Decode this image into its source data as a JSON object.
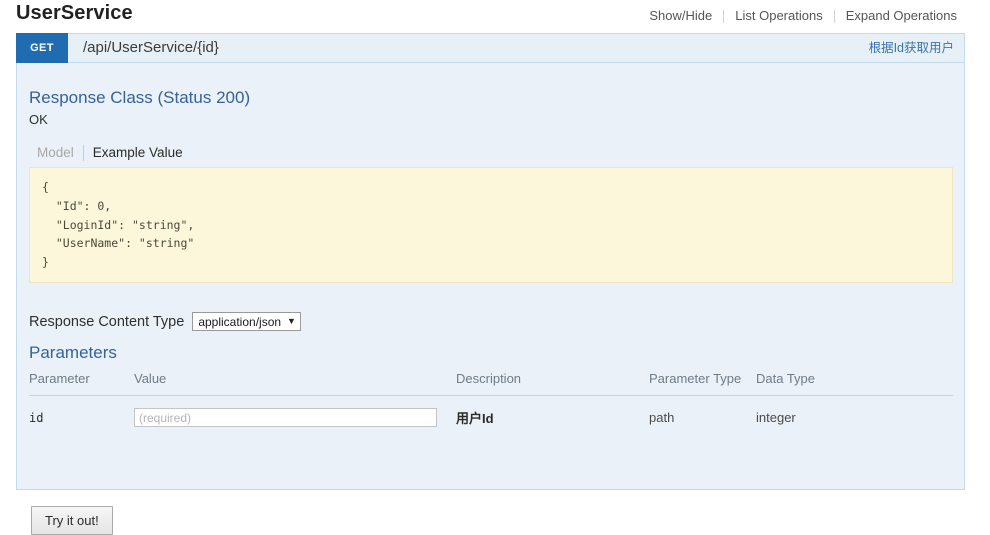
{
  "resource": {
    "title": "UserService",
    "options": [
      {
        "label": "Show/Hide"
      },
      {
        "label": "List Operations"
      },
      {
        "label": "Expand Operations"
      }
    ]
  },
  "operation": {
    "method": "GET",
    "path": "/api/UserService/{id}",
    "summary": "根据Id获取用户",
    "method_color": "#1f6cb0"
  },
  "response_class": {
    "title": "Response Class (Status 200)",
    "status_text": "OK",
    "tabs": [
      {
        "label": "Model",
        "active": false
      },
      {
        "label": "Example Value",
        "active": true
      }
    ],
    "example_value": "{\n  \"Id\": 0,\n  \"LoginId\": \"string\",\n  \"UserName\": \"string\"\n}"
  },
  "content_type": {
    "label": "Response Content Type",
    "selected": "application/json",
    "options": [
      "application/json"
    ]
  },
  "parameters": {
    "title": "Parameters",
    "columns": [
      "Parameter",
      "Value",
      "Description",
      "Parameter Type",
      "Data Type"
    ],
    "rows": [
      {
        "name": "id",
        "value": "",
        "placeholder": "(required)",
        "description": "用户Id",
        "parameter_type": "path",
        "data_type": "integer"
      }
    ]
  },
  "actions": {
    "try_it_out": "Try it out!"
  }
}
